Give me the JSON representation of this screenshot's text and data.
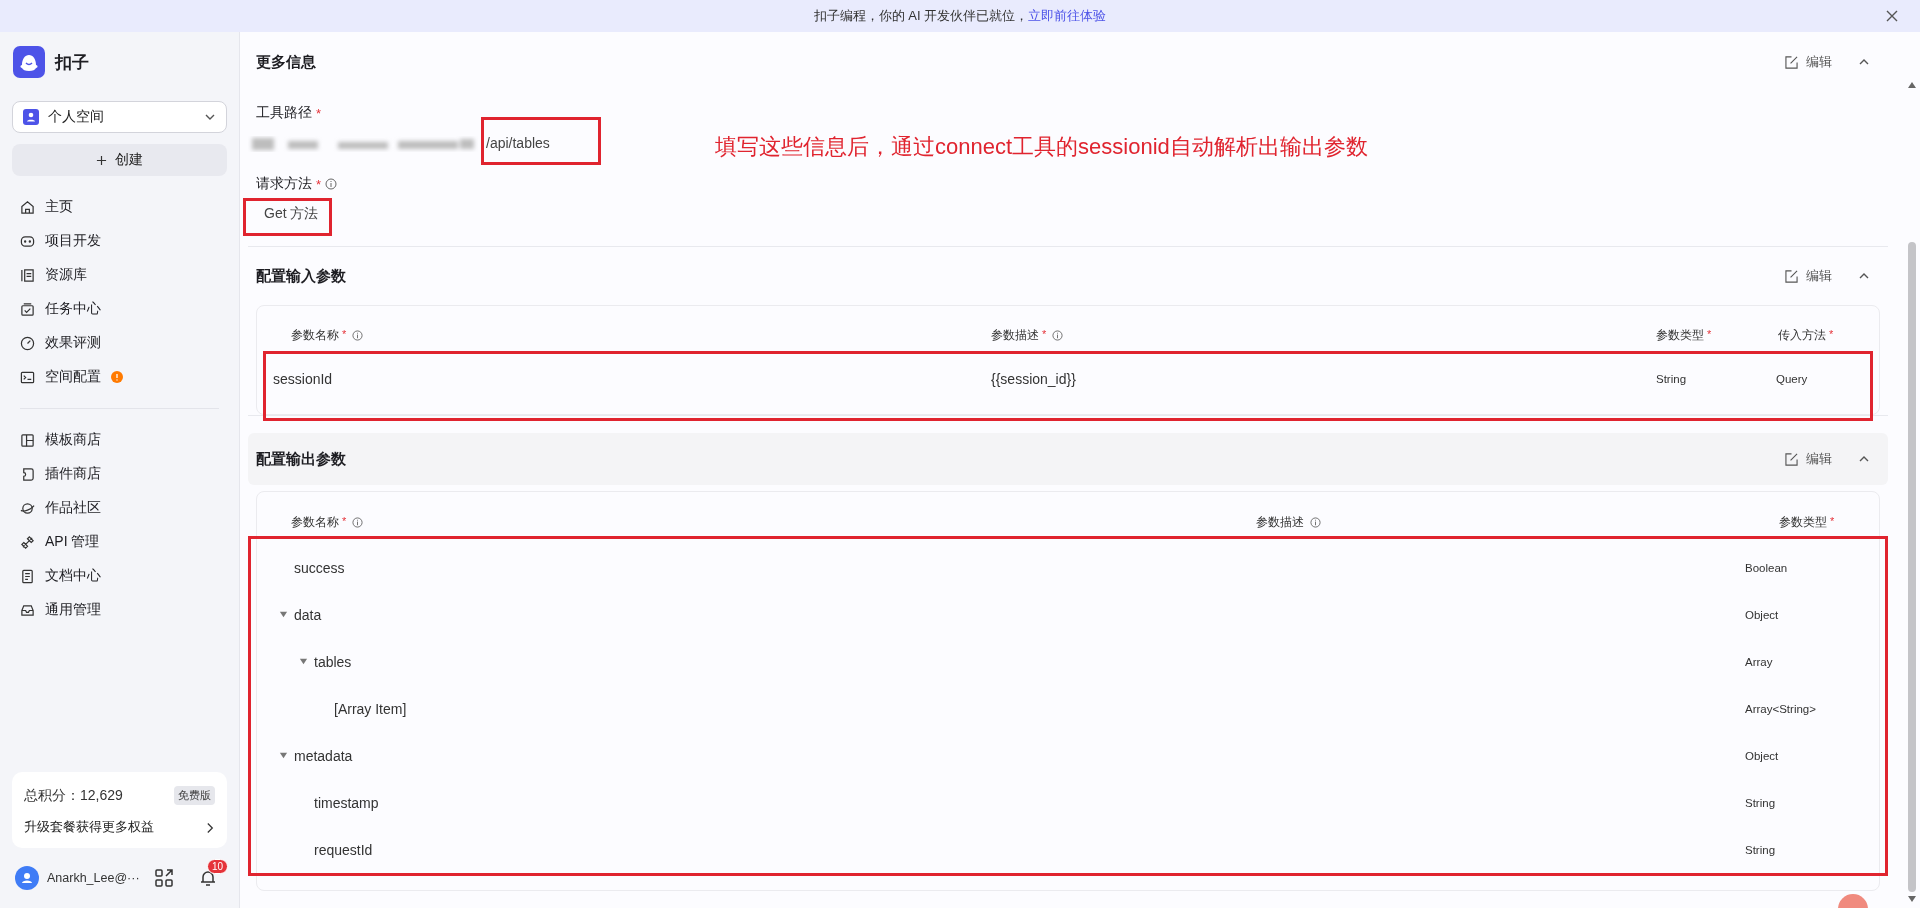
{
  "banner": {
    "text": "扣子编程，你的 AI 开发伙伴已就位，",
    "link": "立即前往体验"
  },
  "sidebar": {
    "brand": "扣子",
    "workspace": "个人空间",
    "create_button": "创建",
    "nav_groups": [
      [
        {
          "label": "主页",
          "alert": false
        },
        {
          "label": "项目开发",
          "alert": false
        },
        {
          "label": "资源库",
          "alert": false
        },
        {
          "label": "任务中心",
          "alert": false
        },
        {
          "label": "效果评测",
          "alert": false
        },
        {
          "label": "空间配置",
          "alert": true
        }
      ],
      [
        {
          "label": "模板商店",
          "alert": false
        },
        {
          "label": "插件商店",
          "alert": false
        },
        {
          "label": "作品社区",
          "alert": false
        },
        {
          "label": "API 管理",
          "alert": false
        },
        {
          "label": "文档中心",
          "alert": false
        },
        {
          "label": "通用管理",
          "alert": false
        }
      ]
    ],
    "points_card": {
      "points": "总积分：12,629",
      "plan": "免费版",
      "upgrade": "升级套餐获得更多权益"
    },
    "user": {
      "name": "Anarkh_Lee@···",
      "notifications": "10"
    }
  },
  "more_info": {
    "title": "更多信息",
    "edit": "编辑",
    "fields": [
      {
        "label": "工具路径",
        "mark": "*",
        "info": false,
        "blurred_prefix": true,
        "value": "/api/tables"
      },
      {
        "label": "请求方法",
        "mark": "*",
        "info": true,
        "blurred_prefix": false,
        "value": "Get 方法"
      }
    ]
  },
  "annotation": "填写这些信息后，通过connect工具的sessionid自动解析出输出参数",
  "input_params": {
    "title": "配置输入参数",
    "edit": "编辑",
    "columns": [
      {
        "label": "参数名称",
        "mark": "*",
        "info": true
      },
      {
        "label": "参数描述",
        "mark": "*",
        "info": true
      },
      {
        "label": "参数类型",
        "mark": "*",
        "info": false
      },
      {
        "label": "传入方法",
        "mark": "*",
        "info": false
      }
    ],
    "rows": [
      {
        "name": "sessionId",
        "description": "{{session_id}}",
        "type": "String",
        "method": "Query"
      }
    ]
  },
  "output_params": {
    "title": "配置输出参数",
    "edit": "编辑",
    "columns": [
      {
        "label": "参数名称",
        "mark": "*",
        "info": true
      },
      {
        "label": "参数描述",
        "info": true
      },
      {
        "label": "参数类型",
        "mark": "*",
        "info": false
      }
    ],
    "rows": [
      {
        "name": "success",
        "type": "Boolean"
      },
      {
        "name": "data",
        "type": "Object",
        "expanded": true,
        "children": [
          {
            "name": "tables",
            "type": "Array",
            "expanded": true,
            "children": [
              {
                "name": "[Array Item]",
                "type": "Array<String>"
              }
            ]
          }
        ]
      },
      {
        "name": "metadata",
        "type": "Object",
        "expanded": true,
        "children": [
          {
            "name": "timestamp",
            "type": "String"
          },
          {
            "name": "requestId",
            "type": "String"
          }
        ]
      }
    ]
  }
}
